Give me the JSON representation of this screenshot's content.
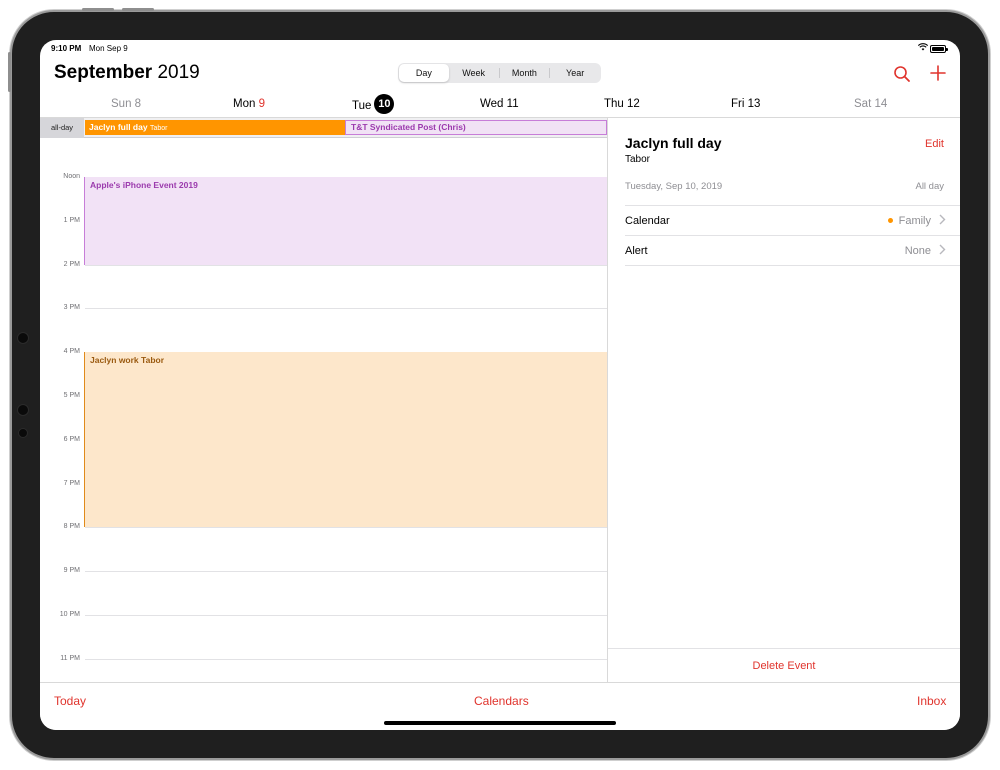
{
  "status_bar": {
    "time": "9:10 PM",
    "date": "Mon Sep 9"
  },
  "header": {
    "month": "September",
    "year": "2019",
    "view_tabs": [
      "Day",
      "Week",
      "Month",
      "Year"
    ],
    "active_tab": "Day"
  },
  "days": [
    {
      "weekday": "Sun",
      "num": "8"
    },
    {
      "weekday": "Mon",
      "num": "9"
    },
    {
      "weekday": "Tue",
      "num": "10"
    },
    {
      "weekday": "Wed",
      "num": "11"
    },
    {
      "weekday": "Thu",
      "num": "12"
    },
    {
      "weekday": "Fri",
      "num": "13"
    },
    {
      "weekday": "Sat",
      "num": "14"
    }
  ],
  "all_day": {
    "label": "all-day",
    "events": [
      {
        "title": "Jaclyn full day",
        "location": "Tabor"
      },
      {
        "title": "T&T Syndicated Post (Chris)"
      }
    ]
  },
  "timeline": {
    "hours": [
      "Noon",
      "1 PM",
      "2 PM",
      "3 PM",
      "4 PM",
      "5 PM",
      "6 PM",
      "7 PM",
      "8 PM",
      "9 PM",
      "10 PM",
      "11 PM"
    ],
    "events": [
      {
        "title": "Apple's iPhone Event 2019",
        "start": "Noon",
        "end": "2 PM"
      },
      {
        "title": "Jaclyn work Tabor",
        "start": "4 PM",
        "end": "8 PM"
      }
    ]
  },
  "detail": {
    "title": "Jaclyn full day",
    "location": "Tabor",
    "edit_label": "Edit",
    "date": "Tuesday, Sep 10, 2019",
    "duration": "All day",
    "rows": [
      {
        "label": "Calendar",
        "value": "Family"
      },
      {
        "label": "Alert",
        "value": "None"
      }
    ],
    "delete_label": "Delete Event"
  },
  "toolbar": {
    "today": "Today",
    "calendars": "Calendars",
    "inbox": "Inbox"
  },
  "colors": {
    "accent": "#e0342d",
    "family_orange": "#ff9500",
    "purple_event": "#9b3aad"
  },
  "icons": [
    "wifi-icon",
    "battery-icon",
    "search-icon",
    "plus-icon",
    "chevron-right-icon"
  ]
}
